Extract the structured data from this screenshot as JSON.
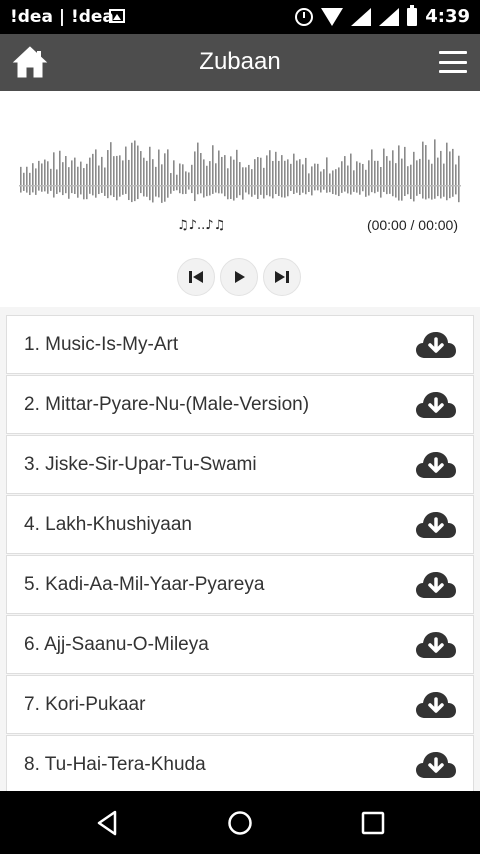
{
  "status_bar": {
    "carrier": "!dea | !dea",
    "time": "4:39",
    "icons": [
      "gallery-icon",
      "alarm-icon",
      "wifi-icon",
      "signal-icon",
      "battery-icon"
    ]
  },
  "header": {
    "title": "Zubaan",
    "left_icon": "home-icon",
    "right_icon": "menu-icon",
    "background": "#4d4d4d"
  },
  "player": {
    "now_playing": "♫♪..♪♫",
    "time": "(00:00 / 00:00)",
    "controls": [
      "previous-icon",
      "play-icon",
      "next-icon"
    ],
    "waveform_color": "#8a8a8a"
  },
  "tracks": [
    {
      "label": "1. Music-Is-My-Art"
    },
    {
      "label": "2. Mittar-Pyare-Nu-(Male-Version)"
    },
    {
      "label": "3. Jiske-Sir-Upar-Tu-Swami"
    },
    {
      "label": "4. Lakh-Khushiyaan"
    },
    {
      "label": "5. Kadi-Aa-Mil-Yaar-Pyareya"
    },
    {
      "label": "6. Ajj-Saanu-O-Mileya"
    },
    {
      "label": "7. Kori-Pukaar"
    },
    {
      "label": "8. Tu-Hai-Tera-Khuda"
    }
  ],
  "nav_bar": {
    "buttons": [
      "back-icon",
      "home-circle-icon",
      "recents-icon"
    ]
  }
}
